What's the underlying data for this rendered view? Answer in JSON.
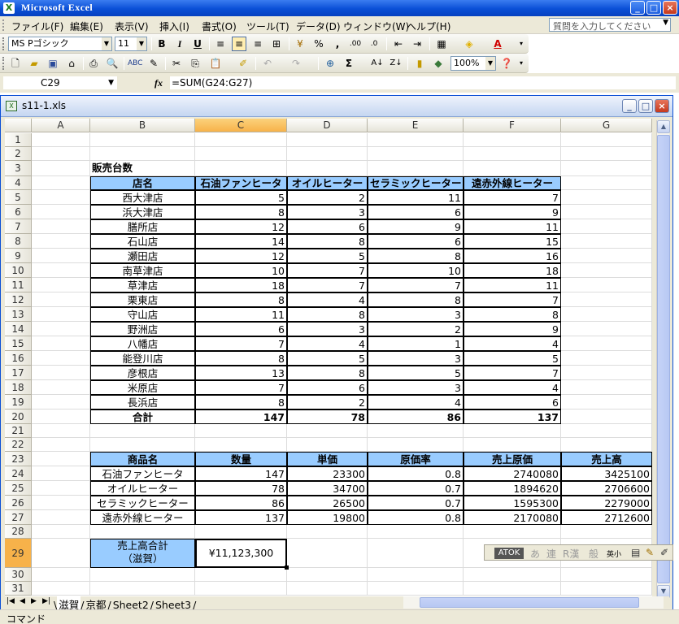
{
  "app": {
    "title": "Microsoft Excel"
  },
  "menu": [
    "ファイル(F)",
    "編集(E)",
    "表示(V)",
    "挿入(I)",
    "書式(O)",
    "ツール(T)",
    "データ(D)",
    "ウィンドウ(W)",
    "ヘルプ(H)"
  ],
  "help_placeholder": "質問を入力してください",
  "toolbar": {
    "font": "MS Pゴシック",
    "size": "11",
    "zoom": "100%"
  },
  "formula_bar": {
    "cell": "C29",
    "formula": "=SUM(G24:G27)"
  },
  "document": {
    "name": "s11-1.xls"
  },
  "columns": [
    "A",
    "B",
    "C",
    "D",
    "E",
    "F",
    "G"
  ],
  "selected_column": "C",
  "selected_row": "29",
  "rows": [
    "1",
    "2",
    "3",
    "4",
    "5",
    "6",
    "7",
    "8",
    "9",
    "10",
    "11",
    "12",
    "13",
    "14",
    "15",
    "16",
    "17",
    "18",
    "19",
    "20",
    "21",
    "22",
    "23",
    "24",
    "25",
    "26",
    "27",
    "28",
    "29",
    "30",
    "31"
  ],
  "table1": {
    "title": "販売台数",
    "headers": [
      "店名",
      "石油ファンヒータ",
      "オイルヒーター",
      "セラミックヒーター",
      "遠赤外線ヒーター"
    ],
    "rows": [
      [
        "西大津店",
        "5",
        "2",
        "11",
        "7"
      ],
      [
        "浜大津店",
        "8",
        "3",
        "6",
        "9"
      ],
      [
        "膳所店",
        "12",
        "6",
        "9",
        "11"
      ],
      [
        "石山店",
        "14",
        "8",
        "6",
        "15"
      ],
      [
        "瀬田店",
        "12",
        "5",
        "8",
        "16"
      ],
      [
        "南草津店",
        "10",
        "7",
        "10",
        "18"
      ],
      [
        "草津店",
        "18",
        "7",
        "7",
        "11"
      ],
      [
        "栗東店",
        "8",
        "4",
        "8",
        "7"
      ],
      [
        "守山店",
        "11",
        "8",
        "3",
        "8"
      ],
      [
        "野洲店",
        "6",
        "3",
        "2",
        "9"
      ],
      [
        "八幡店",
        "7",
        "4",
        "1",
        "4"
      ],
      [
        "能登川店",
        "8",
        "5",
        "3",
        "5"
      ],
      [
        "彦根店",
        "13",
        "8",
        "5",
        "7"
      ],
      [
        "米原店",
        "7",
        "6",
        "3",
        "4"
      ],
      [
        "長浜店",
        "8",
        "2",
        "4",
        "6"
      ]
    ],
    "total": [
      "合計",
      "147",
      "78",
      "86",
      "137"
    ]
  },
  "table2": {
    "headers": [
      "商品名",
      "数量",
      "単価",
      "原価率",
      "売上原価",
      "売上高"
    ],
    "rows": [
      [
        "石油ファンヒータ",
        "147",
        "23300",
        "0.8",
        "2740080",
        "3425100"
      ],
      [
        "オイルヒーター",
        "78",
        "34700",
        "0.7",
        "1894620",
        "2706600"
      ],
      [
        "セラミックヒーター",
        "86",
        "26500",
        "0.7",
        "1595300",
        "2279000"
      ],
      [
        "遠赤外線ヒーター",
        "137",
        "19800",
        "0.8",
        "2170080",
        "2712600"
      ]
    ]
  },
  "summary": {
    "label1": "売上高合計",
    "label2": "（滋賀）",
    "value": "¥11,123,300"
  },
  "sheets": [
    "滋賀",
    "京都",
    "Sheet2",
    "Sheet3"
  ],
  "status": "コマンド",
  "atok": {
    "badge": "ATOK",
    "keys": [
      "あ",
      "連",
      "R漢",
      "般",
      "英小"
    ]
  }
}
